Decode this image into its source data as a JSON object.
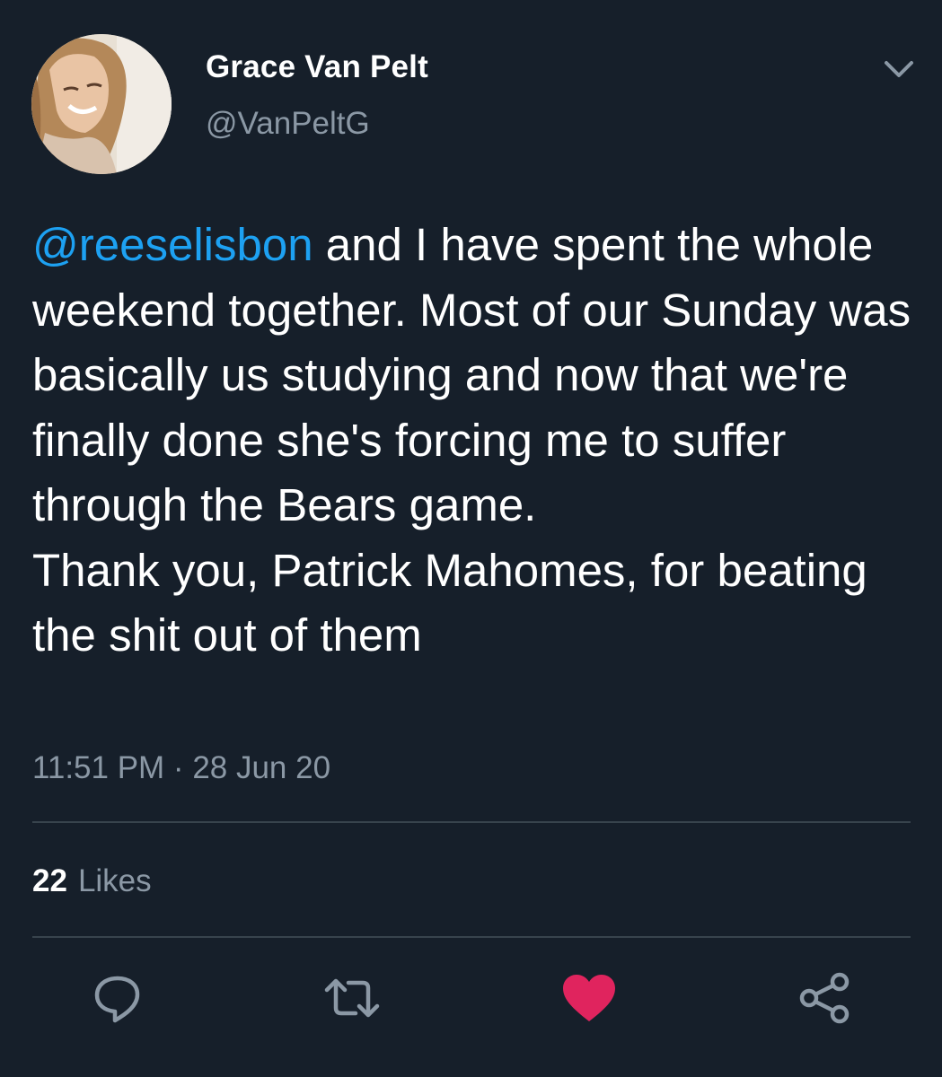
{
  "tweet": {
    "author": {
      "display_name": "Grace Van Pelt",
      "handle": "@VanPeltG"
    },
    "body": {
      "mention": "@reeselisbon",
      "text": " and I have spent the whole weekend together. Most of our Sunday was basically us studying and now that we're finally done she's forcing me to suffer through the Bears game.\nThank you, Patrick Mahomes, for beating the shit out of them"
    },
    "timestamp": "11:51 PM · 28 Jun 20",
    "stats": {
      "likes_count": "22",
      "likes_label": "Likes"
    },
    "actions": {
      "reply_icon": "reply-icon",
      "retweet_icon": "retweet-icon",
      "like_icon": "heart-icon",
      "share_icon": "share-icon"
    }
  },
  "colors": {
    "background": "#161f2a",
    "mention": "#1da1f2",
    "secondary_text": "#8b98a5",
    "like_active": "#e0245e",
    "divider": "#38444d"
  }
}
